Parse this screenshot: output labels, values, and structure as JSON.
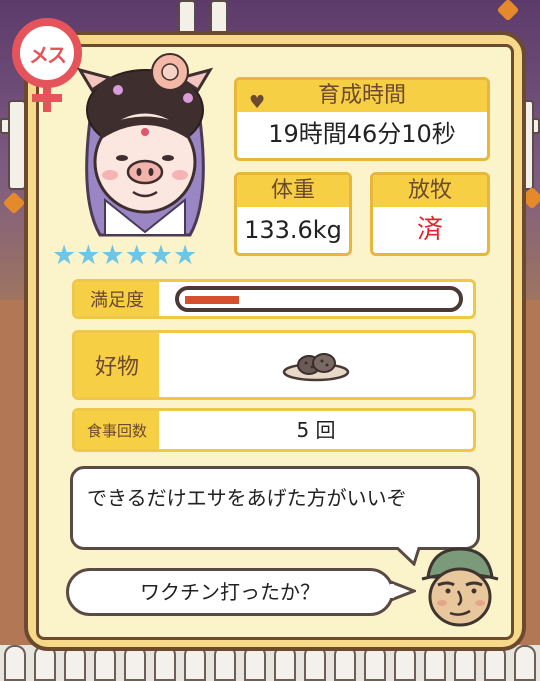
{
  "gender_badge": {
    "label": "メス",
    "color": "#e4545a"
  },
  "portrait": {
    "icon": "pig-in-hood-portrait-icon"
  },
  "rating": {
    "stars": "★★★★★★",
    "count": 6,
    "color": "#6ec6e6"
  },
  "raising_time": {
    "label": "育成時間",
    "icon": "heart-icon",
    "value": "19時間46分10秒"
  },
  "weight": {
    "label": "体重",
    "value": "133.6kg"
  },
  "grazing": {
    "label": "放牧",
    "value": "済",
    "value_color": "#e0262c"
  },
  "satisfaction": {
    "label": "満足度",
    "fraction": 0.2
  },
  "favorite": {
    "label": "好物",
    "icon": "cookie-plate-icon"
  },
  "meal_count": {
    "label": "食事回数",
    "value": "5 回"
  },
  "dialog": {
    "speech_1": "できるだけエサをあげた方がいいぞ",
    "speech_2": "ワクチン打ったか？",
    "speaker_icon": "farmer-avatar-icon"
  },
  "colors": {
    "panel_border": "#6b4a2f",
    "header_yellow": "#f7cf45",
    "bar_fill": "#d5502e"
  }
}
